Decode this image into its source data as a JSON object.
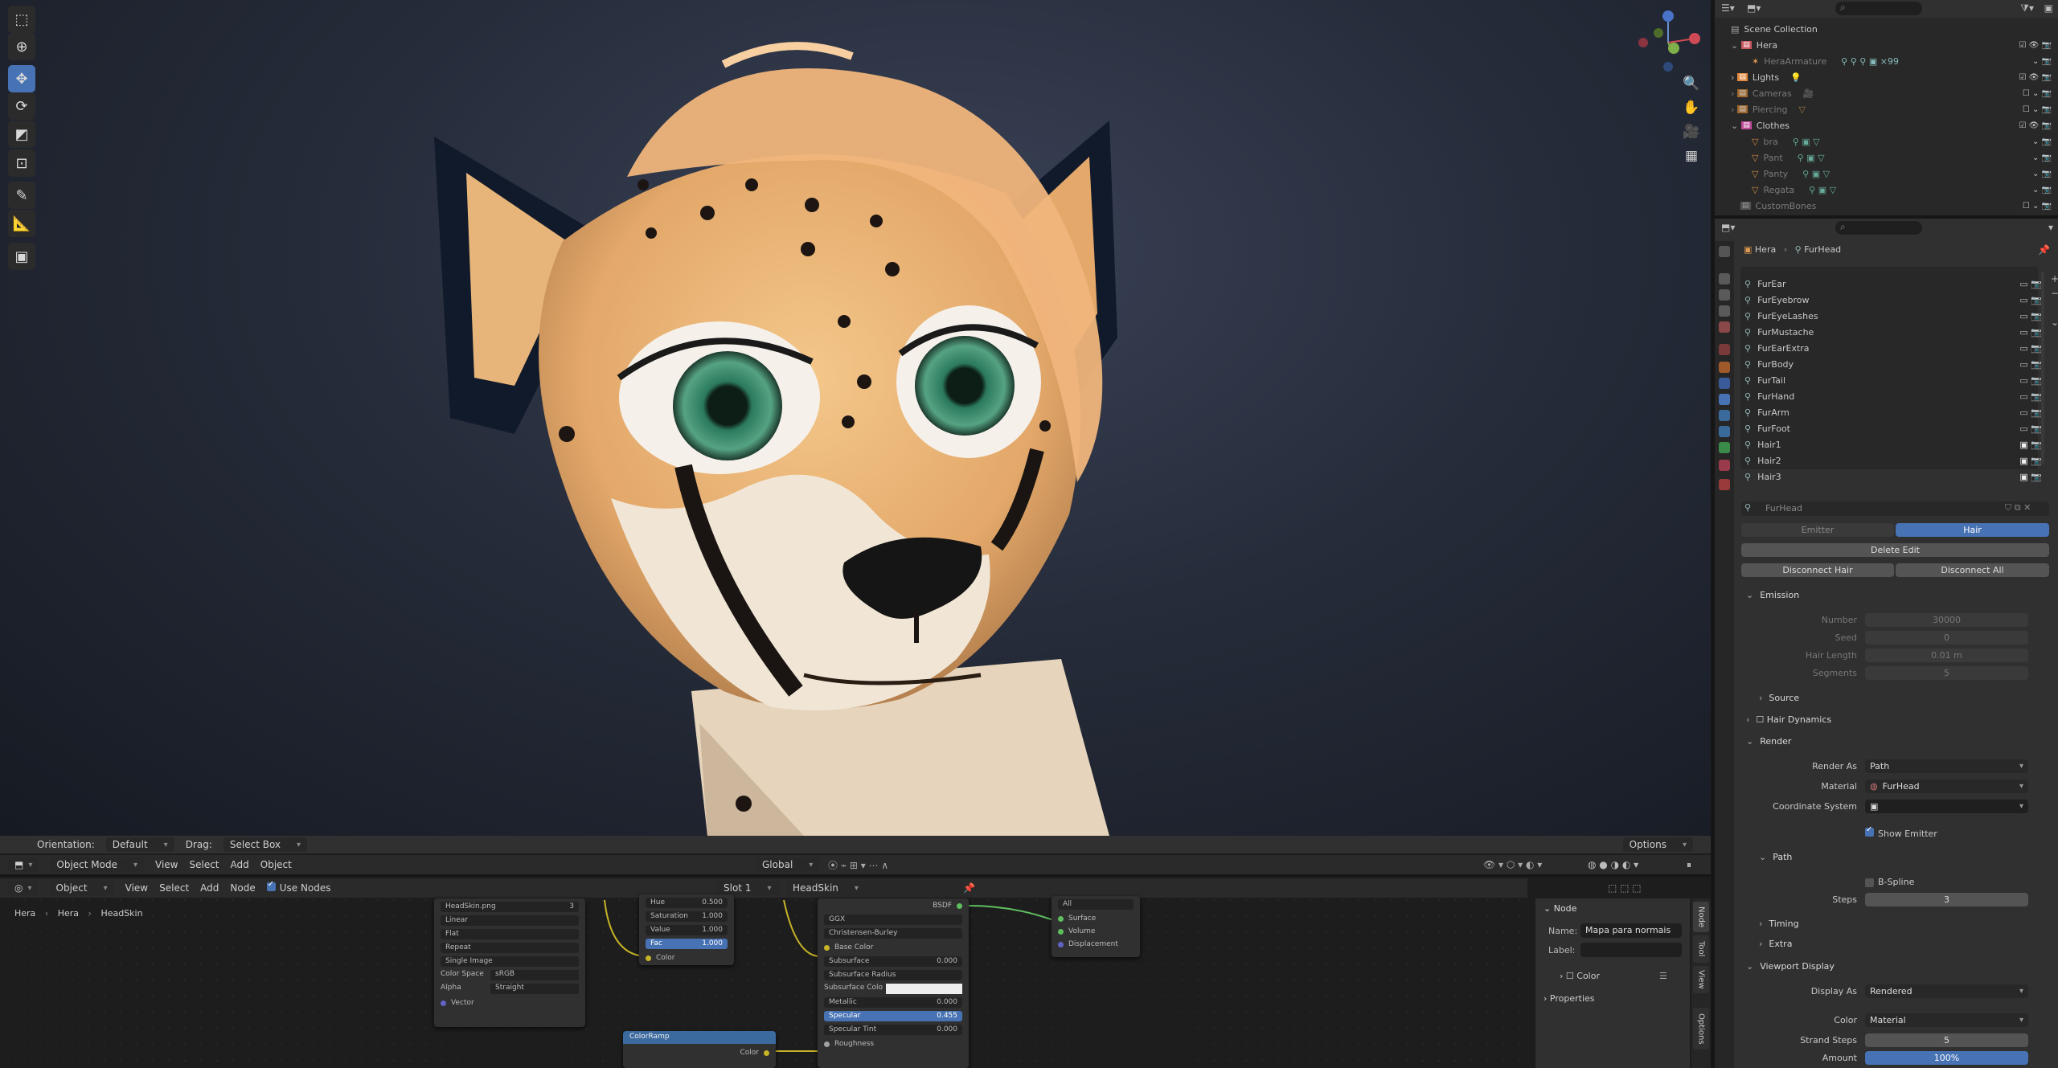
{
  "viewport": {
    "header": {
      "orientation_label": "Orientation:",
      "orientation_value": "Default",
      "drag_label": "Drag:",
      "drag_value": "Select Box",
      "options": "Options"
    },
    "mode_bar": {
      "mode": "Object Mode",
      "menus": [
        "View",
        "Select",
        "Add",
        "Object"
      ],
      "transform": "Global"
    }
  },
  "node_editor": {
    "header": {
      "type": "Object",
      "menus": [
        "View",
        "Select",
        "Add",
        "Node"
      ],
      "use_nodes": "Use Nodes",
      "slot": "Slot 1",
      "material": "HeadSkin"
    },
    "breadcrumb": [
      "Hera",
      "Hera",
      "HeadSkin"
    ],
    "image_node": {
      "image": "HeadSkin.png",
      "users": "3",
      "interpolation": "Linear",
      "projection": "Flat",
      "extension": "Repeat",
      "source": "Single Image",
      "color_space_label": "Color Space",
      "color_space": "sRGB",
      "alpha_label": "Alpha",
      "alpha": "Straight",
      "vector": "Vector"
    },
    "hsv_node": {
      "fields": [
        {
          "label": "Hue",
          "value": "0.500"
        },
        {
          "label": "Saturation",
          "value": "1.000"
        },
        {
          "label": "Value",
          "value": "1.000"
        },
        {
          "label": "Fac",
          "value": "1.000"
        }
      ],
      "color": "Color"
    },
    "bsdf_node": {
      "title": "BSDF",
      "distribution": "GGX",
      "subsurface_method": "Christensen-Burley",
      "base_color": "Base Color",
      "fields": [
        {
          "label": "Subsurface",
          "value": "0.000"
        },
        {
          "label": "Subsurface Radius",
          "value": ""
        },
        {
          "label": "Subsurface Colo",
          "value": ""
        },
        {
          "label": "Metallic",
          "value": "0.000"
        },
        {
          "label": "Specular",
          "value": "0.455"
        },
        {
          "label": "Specular Tint",
          "value": "0.000"
        }
      ],
      "roughness": "Roughness"
    },
    "output_node": {
      "target": "All",
      "sockets": [
        "Surface",
        "Volume",
        "Displacement"
      ]
    },
    "colorramp_node": {
      "title": "ColorRamp",
      "color": "Color"
    },
    "side_panel": {
      "section": "Node",
      "name_label": "Name:",
      "name_value": "Mapa para normais",
      "label_label": "Label:",
      "color": "Color",
      "properties": "Properties"
    },
    "tabs": [
      "Node",
      "Tool",
      "View",
      "Options"
    ]
  },
  "outliner": {
    "title": "Scene Collection",
    "rows": [
      {
        "name": "Hera",
        "kind": "collection"
      },
      {
        "name": "HeraArmature",
        "kind": "object",
        "dim": true,
        "extra": "×99"
      },
      {
        "name": "Lights",
        "kind": "collection"
      },
      {
        "name": "Cameras",
        "kind": "collection",
        "dim": true
      },
      {
        "name": "Piercing",
        "kind": "collection",
        "dim": true
      },
      {
        "name": "Clothes",
        "kind": "collection"
      },
      {
        "name": "bra",
        "kind": "object",
        "dim": true
      },
      {
        "name": "Pant",
        "kind": "object",
        "dim": true
      },
      {
        "name": "Panty",
        "kind": "object",
        "dim": true
      },
      {
        "name": "Regata",
        "kind": "object",
        "dim": true
      },
      {
        "name": "CustomBones",
        "kind": "collection",
        "dim": true
      }
    ]
  },
  "properties": {
    "breadcrumb": [
      "Hera",
      "FurHead"
    ],
    "particle_systems": [
      "FurEar",
      "FurEyebrow",
      "FurEyeLashes",
      "FurMustache",
      "FurEarExtra",
      "FurBody",
      "FurTail",
      "FurHand",
      "FurArm",
      "FurFoot",
      "Hair1",
      "Hair2",
      "Hair3"
    ],
    "settings_name": "FurHead",
    "type_tabs": [
      "Emitter",
      "Hair"
    ],
    "buttons": {
      "delete_edit": "Delete Edit",
      "disconnect_hair": "Disconnect Hair",
      "disconnect_all": "Disconnect All"
    },
    "emission": {
      "title": "Emission",
      "fields": [
        {
          "label": "Number",
          "value": "30000"
        },
        {
          "label": "Seed",
          "value": "0"
        },
        {
          "label": "Hair Length",
          "value": "0.01 m"
        },
        {
          "label": "Segments",
          "value": "5"
        }
      ],
      "source": "Source"
    },
    "hair_dynamics": "Hair Dynamics",
    "render": {
      "title": "Render",
      "render_as_label": "Render As",
      "render_as": "Path",
      "material_label": "Material",
      "material": "FurHead",
      "coord_label": "Coordinate System",
      "show_emitter": "Show Emitter",
      "path": "Path",
      "bspline": "B-Spline",
      "steps_label": "Steps",
      "steps": "3",
      "timing": "Timing",
      "extra": "Extra"
    },
    "viewport_display": {
      "title": "Viewport Display",
      "display_as_label": "Display As",
      "display_as": "Rendered",
      "color_label": "Color",
      "color": "Material",
      "strand_steps_label": "Strand Steps",
      "strand_steps": "5",
      "amount_label": "Amount",
      "amount": "100%"
    }
  },
  "colors": {
    "accent": "#4772b3",
    "panel": "#303030",
    "dark": "#1d1d1d"
  }
}
